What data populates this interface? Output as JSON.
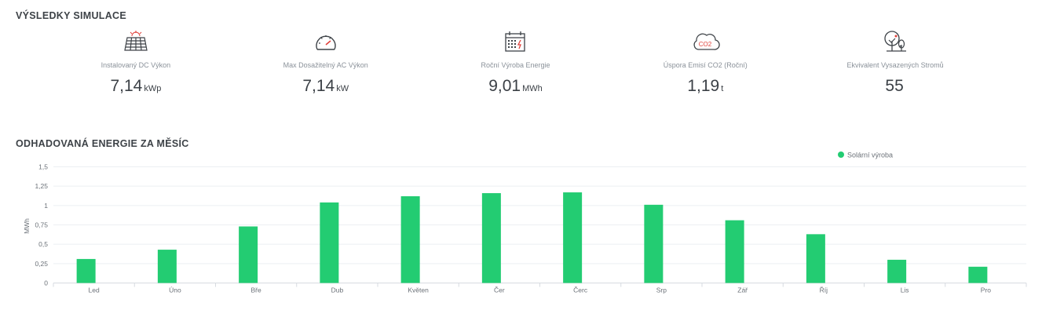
{
  "section_results": {
    "title": "VÝSLEDKY SIMULACE"
  },
  "stats": [
    {
      "label": "Instalovaný DC Výkon",
      "value": "7,14",
      "unit": "kWp",
      "icon": "solar-panel-icon"
    },
    {
      "label": "Max Dosažitelný AC Výkon",
      "value": "7,14",
      "unit": "kW",
      "icon": "speedometer-icon"
    },
    {
      "label": "Roční Výroba Energie",
      "value": "9,01",
      "unit": "MWh",
      "icon": "calendar-energy-icon"
    },
    {
      "label": "Úspora Emisí CO2 (Roční)",
      "value": "1,19",
      "unit": "t",
      "icon": "co2-cloud-icon"
    },
    {
      "label": "Ekvivalent Vysazených Stromů",
      "value": "55",
      "unit": "",
      "icon": "trees-icon"
    }
  ],
  "colors": {
    "bar": "#23cc72",
    "icon_accent": "#e0413b",
    "icon_stroke": "#3d4247"
  },
  "chart_data": {
    "type": "bar",
    "title": "ODHADOVANÁ ENERGIE ZA MĚSÍC",
    "categories": [
      "Led",
      "Úno",
      "Bře",
      "Dub",
      "Květen",
      "Čer",
      "Čerc",
      "Srp",
      "Zář",
      "Říj",
      "Lis",
      "Pro"
    ],
    "series": [
      {
        "name": "Solární výroba",
        "values": [
          0.31,
          0.43,
          0.73,
          1.04,
          1.12,
          1.16,
          1.17,
          1.01,
          0.81,
          0.63,
          0.3,
          0.21
        ]
      }
    ],
    "yticks": [
      "0",
      "0,25",
      "0,5",
      "0,75",
      "1",
      "1,25",
      "1,5"
    ],
    "ylim": [
      0,
      1.5
    ],
    "ylabel": "MWh",
    "xlabel": "",
    "grid": true,
    "legend_position": "top-right"
  }
}
